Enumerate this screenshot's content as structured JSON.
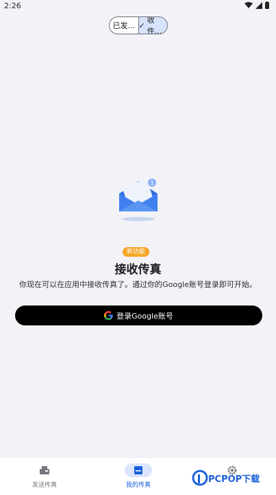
{
  "status_bar": {
    "time": "2:26"
  },
  "segmented": {
    "sent_label": "已发...",
    "received_label": "收件..."
  },
  "badge": "新功能",
  "title": "接收传真",
  "description": "你现在可以在应用中接收传真了。通过你的Google账号登录即可开始。",
  "google_button": {
    "label": "登录Google账号"
  },
  "bottom_nav": {
    "items": [
      {
        "label": "发送传真",
        "icon": "fax-icon",
        "active": false
      },
      {
        "label": "我的传真",
        "icon": "inbox-icon",
        "active": true
      },
      {
        "label": "",
        "icon": "gear-icon",
        "active": false
      }
    ]
  },
  "watermark": {
    "text": "PCPOP下载"
  },
  "colors": {
    "accent": "#1a5fd9",
    "badge": "#f5a623",
    "button": "#000000",
    "selected_segment": "#d7e3fb"
  }
}
